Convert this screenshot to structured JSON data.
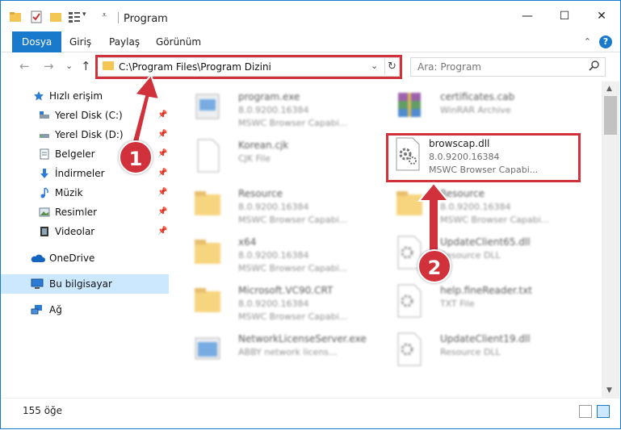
{
  "window": {
    "title": "Program",
    "minimize_glyph": "—",
    "maximize_glyph": "☐",
    "close_glyph": "✕"
  },
  "ribbon": {
    "tabs": [
      "Dosya",
      "Giriş",
      "Paylaş",
      "Görünüm"
    ],
    "active_tab": "Dosya",
    "help_glyph": "?",
    "collapse_glyph": "⌃",
    "accent_color": "#1979ca"
  },
  "nav": {
    "back_glyph": "←",
    "forward_glyph": "→",
    "recent_glyph": "⌄",
    "up_glyph": "↑",
    "address": "C:\\Program Files\\Program Dizini",
    "address_dropdown_glyph": "⌄",
    "refresh_glyph": "↻",
    "search_placeholder": "Ara: Program",
    "search_glyph": "⚲"
  },
  "sidebar": {
    "items": [
      {
        "label": "Hızlı erişim",
        "icon": "star-icon",
        "pinned": false
      },
      {
        "label": "Yerel Disk (C:)",
        "icon": "drive-icon",
        "pinned": true
      },
      {
        "label": "Yerel Disk (D:)",
        "icon": "drive-icon",
        "pinned": true
      },
      {
        "label": "Belgeler",
        "icon": "documents-icon",
        "pinned": true
      },
      {
        "label": "İndirmeler",
        "icon": "download-icon",
        "pinned": true
      },
      {
        "label": "Müzik",
        "icon": "music-icon",
        "pinned": true
      },
      {
        "label": "Resimler",
        "icon": "pictures-icon",
        "pinned": true
      },
      {
        "label": "Videolar",
        "icon": "video-icon",
        "pinned": true
      },
      {
        "label": "OneDrive",
        "icon": "cloud-icon",
        "pinned": false
      },
      {
        "label": "Bu bilgisayar",
        "icon": "computer-icon",
        "pinned": false,
        "selected": true
      },
      {
        "label": "Ağ",
        "icon": "network-icon",
        "pinned": false
      }
    ],
    "pin_glyph": "📌"
  },
  "files": [
    {
      "name": "program.exe",
      "line1": "8.0.9200.16384",
      "line2": "MSWC Browser Capabi...",
      "icon": "exe-icon",
      "blurred": true
    },
    {
      "name": "certificates.cab",
      "line1": "WinRAR Archive",
      "line2": "",
      "icon": "archive-icon",
      "blurred": true
    },
    {
      "name": "Korean.cjk",
      "line1": "CJK File",
      "line2": "",
      "icon": "file-icon",
      "blurred": true
    },
    {
      "name": "browscap.dll",
      "line1": "8.0.9200.16384",
      "line2": "MSWC Browser Capabi...",
      "icon": "dll-gear-icon",
      "blurred": false
    },
    {
      "name": "Resource",
      "line1": "8.0.9200.16384",
      "line2": "MSWC Browser Capabi...",
      "icon": "folder-icon",
      "blurred": true
    },
    {
      "name": "Resource",
      "line1": "8.0.9200.16384",
      "line2": "MSWC Browser Capabi...",
      "icon": "folder-icon",
      "blurred": true
    },
    {
      "name": "x64",
      "line1": "8.0.9200.16384",
      "line2": "MSWC Browser Capabi...",
      "icon": "folder-icon",
      "blurred": true
    },
    {
      "name": "UpdateClient65.dll",
      "line1": "Resource DLL",
      "line2": "",
      "icon": "dll-gear-icon",
      "blurred": true
    },
    {
      "name": "Microsoft.VC90.CRT",
      "line1": "8.0.9200.16384",
      "line2": "MSWC Browser Capabi...",
      "icon": "folder-icon",
      "blurred": true
    },
    {
      "name": "help.fineReader.txt",
      "line1": "TXT File",
      "line2": "",
      "icon": "txt-icon",
      "blurred": true
    },
    {
      "name": "NetworkLicenseServer.exe",
      "line1": "ABBY network licens...",
      "line2": "",
      "icon": "exe-window-icon",
      "blurred": true
    },
    {
      "name": "UpdateClient19.dll",
      "line1": "Resource DLL",
      "line2": "",
      "icon": "dll-gear-icon",
      "blurred": true
    }
  ],
  "status": {
    "count": "155 öğe"
  },
  "annotations": {
    "badge_1": "1",
    "badge_2": "2",
    "color": "#d0313b"
  }
}
